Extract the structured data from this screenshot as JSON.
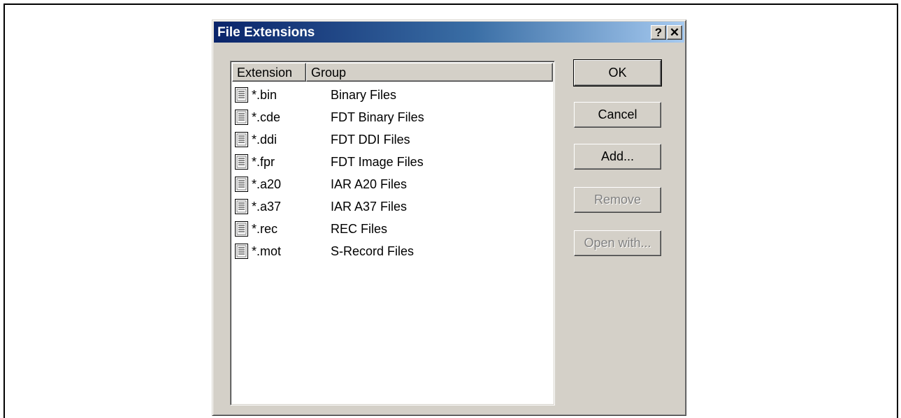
{
  "dialog": {
    "title": "File Extensions",
    "help_glyph": "?",
    "close_glyph": "✕"
  },
  "list": {
    "columns": [
      "Extension",
      "Group"
    ],
    "rows": [
      {
        "extension": "*.bin",
        "group": "Binary Files",
        "icon": "document-icon"
      },
      {
        "extension": "*.cde",
        "group": "FDT Binary Files",
        "icon": "document-icon"
      },
      {
        "extension": "*.ddi",
        "group": "FDT DDI Files",
        "icon": "document-icon"
      },
      {
        "extension": "*.fpr",
        "group": "FDT Image Files",
        "icon": "document-icon"
      },
      {
        "extension": "*.a20",
        "group": "IAR A20 Files",
        "icon": "document-icon"
      },
      {
        "extension": "*.a37",
        "group": "IAR A37 Files",
        "icon": "document-icon"
      },
      {
        "extension": "*.rec",
        "group": "REC Files",
        "icon": "document-icon"
      },
      {
        "extension": "*.mot",
        "group": "S-Record Files",
        "icon": "document-icon"
      }
    ]
  },
  "buttons": {
    "ok": "OK",
    "cancel": "Cancel",
    "add": "Add...",
    "remove": "Remove",
    "open_with": "Open with..."
  },
  "colors": {
    "titlebar_start": "#0a246a",
    "titlebar_end": "#a6caf0",
    "face": "#d4d0c8",
    "disabled_text": "#808080"
  }
}
